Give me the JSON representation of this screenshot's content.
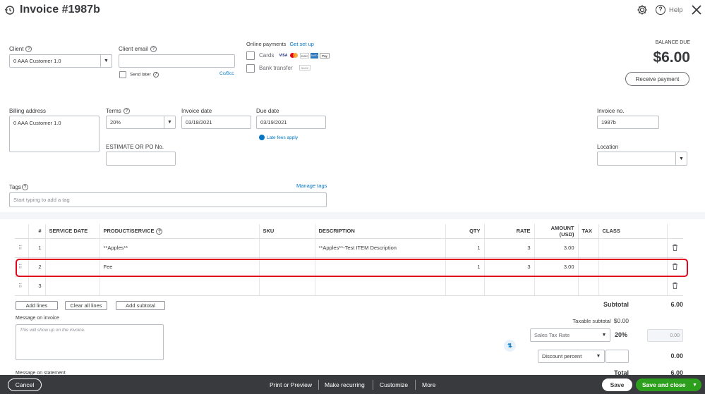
{
  "header": {
    "title": "Invoice #1987b",
    "help_label": "Help"
  },
  "client": {
    "label": "Client",
    "value": "0 AAA Customer 1.0",
    "email_label": "Client email",
    "email_value": "",
    "send_later_label": "Send later",
    "cc_bcc_label": "Cc/Bcc"
  },
  "online_payments": {
    "label": "Online payments",
    "setup_link": "Get set up",
    "cards_label": "Cards",
    "bank_label": "Bank transfer",
    "card_brands": [
      "VISA",
      "MC",
      "DISC",
      "AMEX",
      "Pay"
    ],
    "bank_badge": "BANK"
  },
  "balance": {
    "label": "BALANCE DUE",
    "amount": "$6.00",
    "receive_payment_label": "Receive payment"
  },
  "billing": {
    "label": "Billing address",
    "value": "0 AAA Customer 1.0"
  },
  "terms": {
    "label": "Terms",
    "value": "20%"
  },
  "invoice_date": {
    "label": "Invoice date",
    "value": "03/18/2021"
  },
  "due_date": {
    "label": "Due date",
    "value": "03/19/2021",
    "late_fees_label": "Late fees apply"
  },
  "estimate_po": {
    "label": "ESTIMATE OR PO No.",
    "value": ""
  },
  "invoice_no": {
    "label": "Invoice no.",
    "value": "1987b"
  },
  "location": {
    "label": "Location",
    "value": ""
  },
  "tags": {
    "label": "Tags",
    "manage_link": "Manage tags",
    "placeholder": "Start typing to add a tag"
  },
  "table": {
    "headers": [
      "#",
      "SERVICE DATE",
      "PRODUCT/SERVICE",
      "SKU",
      "DESCRIPTION",
      "QTY",
      "RATE",
      "AMOUNT (USD)",
      "TAX",
      "CLASS"
    ],
    "rows": [
      {
        "num": "1",
        "date": "",
        "product": "**Apples**",
        "sku": "",
        "desc": "**Apples**-Test ITEM Description",
        "qty": "1",
        "rate": "3",
        "amount": "3.00",
        "tax": "",
        "class": ""
      },
      {
        "num": "2",
        "date": "",
        "product": "Fee",
        "sku": "",
        "desc": "",
        "qty": "1",
        "rate": "3",
        "amount": "3.00",
        "tax": "",
        "class": ""
      },
      {
        "num": "3",
        "date": "",
        "product": "",
        "sku": "",
        "desc": "",
        "qty": "",
        "rate": "",
        "amount": "",
        "tax": "",
        "class": ""
      }
    ],
    "highlight_color": "#e0061f"
  },
  "line_buttons": {
    "add_lines": "Add lines",
    "clear_all": "Clear all lines",
    "add_subtotal": "Add subtotal"
  },
  "message": {
    "label": "Message on invoice",
    "placeholder": "This will show up on the invoice.",
    "statement_label": "Message on statement"
  },
  "totals": {
    "subtotal_label": "Subtotal",
    "subtotal_value": "6.00",
    "taxable_subtotal_label": "Taxable subtotal",
    "taxable_subtotal_value": "$0.00",
    "tax_rate_select": "Sales Tax Rate",
    "tax_percent": "20%",
    "tax_amount": "0.00",
    "discount_select": "Discount percent",
    "discount_value": "",
    "discount_amount": "0.00",
    "total_label": "Total",
    "total_value": "6.00"
  },
  "footer": {
    "cancel": "Cancel",
    "print_preview": "Print or Preview",
    "make_recurring": "Make recurring",
    "customize": "Customize",
    "more": "More",
    "save": "Save",
    "save_close": "Save and close"
  },
  "colors": {
    "accent_green": "#2ca01c",
    "link_blue": "#0077c5",
    "footer_bg": "#393a3d"
  }
}
